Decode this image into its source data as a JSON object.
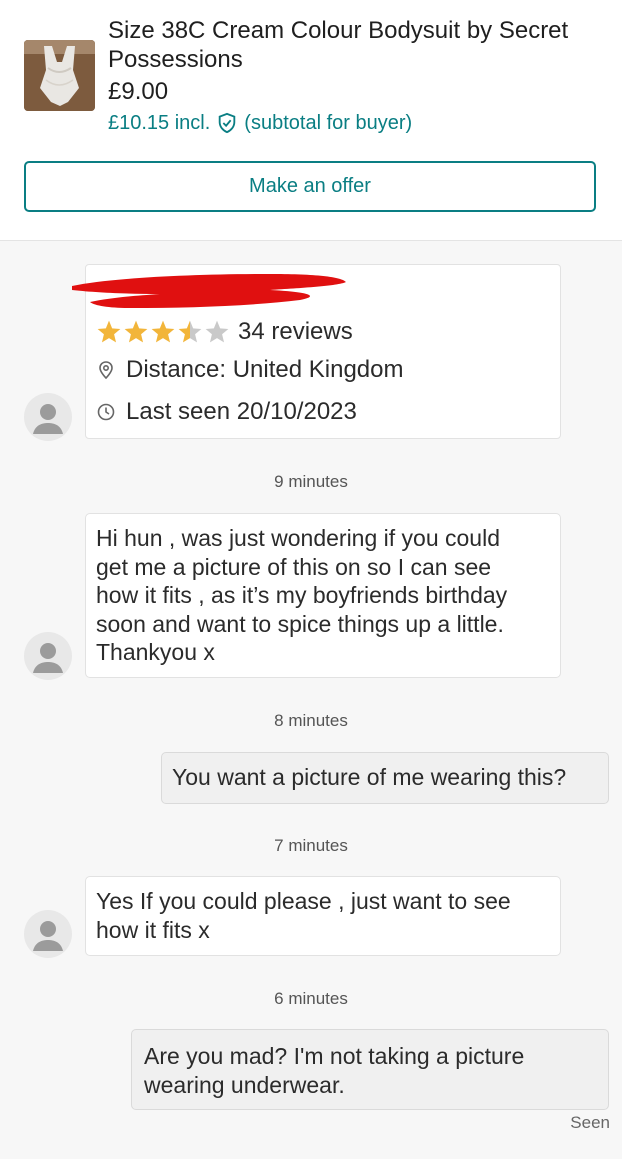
{
  "item": {
    "title": "Size 38C Cream Colour Bodysuit by Secret Possessions",
    "price": "£9.00",
    "incl_price": "£10.15 incl.",
    "subtotal_label": "(subtotal for buyer)",
    "offer_button": "Make an offer",
    "thumbnail_icon": "bodysuit-thumbnail"
  },
  "seller": {
    "rating": 3.5,
    "max_rating": 5,
    "reviews": "34 reviews",
    "distance": "Distance: United Kingdom",
    "last_seen": "Last seen 20/10/2023",
    "name_redacted": true
  },
  "messages": [
    {
      "time": "9 minutes",
      "from": "them",
      "lines": [
        "Hi hun , was just wondering if you could",
        "get me a picture of this on so I can see",
        "how it fits , as it’s my boyfriends birthday",
        "soon and want to spice things up a little.",
        "Thankyou x"
      ]
    },
    {
      "time": "8 minutes",
      "from": "me",
      "lines": [
        "You want a picture of me wearing this?"
      ]
    },
    {
      "time": "7 minutes",
      "from": "them",
      "lines": [
        "Yes If you could please , just want to see",
        "how it fits x"
      ]
    },
    {
      "time": "6 minutes",
      "from": "me",
      "lines": [
        "Are you mad? I'm not taking a picture",
        "wearing underwear."
      ]
    }
  ],
  "status": {
    "seen": "Seen"
  },
  "colors": {
    "accent": "#0a7e83",
    "star": "#f2b53a",
    "star_empty": "#c9c9c9",
    "redaction": "#e01010"
  }
}
